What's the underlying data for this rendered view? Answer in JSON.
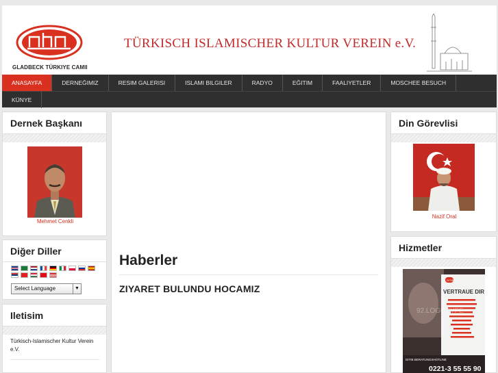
{
  "header": {
    "logo_caption": "GLADBECK TÜRKIYE CAMII",
    "site_title": "TÜRKISCH ISLAMISCHER KULTUR VEREIN e.V."
  },
  "nav": {
    "row1": [
      "ANASAYFA",
      "DERNEĞIMIZ",
      "RESIM GALERISI",
      "ISLAMI BILGILER",
      "RADYO",
      "EĞITIM",
      "FAALIYETLER",
      "MOSCHEE BESUCH"
    ],
    "row2": [
      "KÜNYE"
    ],
    "active": "ANASAYFA"
  },
  "left": {
    "president": {
      "title": "Dernek Başkanı",
      "name": "Mehmet Cenkli"
    },
    "languages": {
      "title": "Diğer Diller",
      "select_value": "Select Language"
    },
    "contact": {
      "title": "Iletisim",
      "text": "Türkisch-Islamischer Kultur Verein e.V."
    }
  },
  "right": {
    "imam": {
      "title": "Din Görevlisi",
      "name": "Nazif Oral"
    },
    "services": {
      "title": "Hizmetler"
    }
  },
  "main": {
    "news_heading": "Haberler",
    "news_item": "ZIYARET BULUNDU HOCAMIZ"
  },
  "ad": {
    "headline": "VERTRAUE DIR",
    "footer_label": "DITIB BERATUNGSHOTLINE",
    "phone": "0221-3 55 55 90",
    "logo_text": "DITIB",
    "watermark": "92.LOGOTYPE"
  },
  "colors": {
    "accent": "#d9301f",
    "title_red": "#c02a2a",
    "nav_bg": "#2f2f2f"
  },
  "flags": [
    "gb",
    "sa",
    "nl",
    "fr",
    "de",
    "it",
    "pl",
    "ru",
    "es",
    "rs",
    "al",
    "hu",
    "tr",
    "my"
  ]
}
